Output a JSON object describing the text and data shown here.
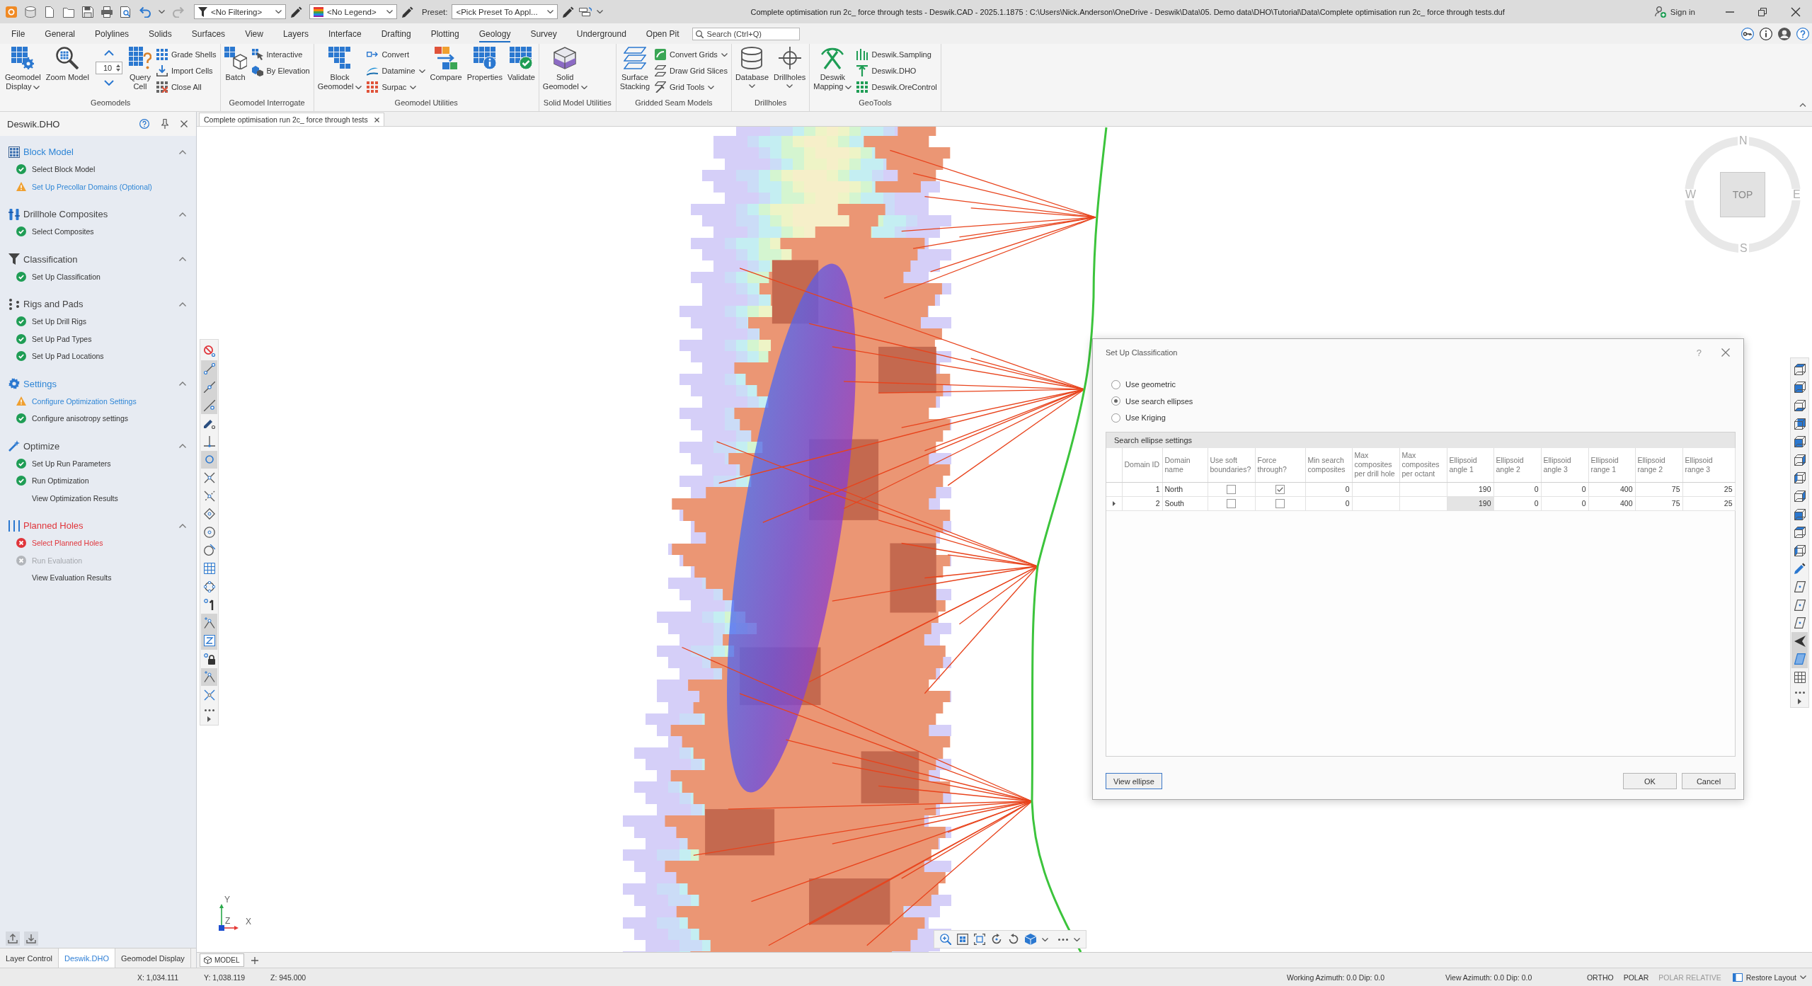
{
  "title_bar": {
    "filters": [
      {
        "kind": "filter",
        "value": "<No Filtering>"
      },
      {
        "kind": "legend",
        "value": "<No Legend>"
      }
    ],
    "preset_label": "Preset:",
    "preset_value": "<Pick Preset To Appl...",
    "title": "Complete optimisation run 2c_ force through tests - Deswik.CAD - 2025.1.1875 : C:\\Users\\Nick.Anderson\\OneDrive - Deswik\\Data\\05. Demo data\\DHO\\Tutorial\\Data\\Complete optimisation run 2c_ force through tests.duf",
    "sign_in": "Sign in"
  },
  "ribbon_tabs": [
    {
      "label": "File",
      "selected": false
    },
    {
      "label": "General",
      "selected": false
    },
    {
      "label": "Polylines",
      "selected": false
    },
    {
      "label": "Solids",
      "selected": false
    },
    {
      "label": "Surfaces",
      "selected": false
    },
    {
      "label": "View",
      "selected": false
    },
    {
      "label": "Layers",
      "selected": false
    },
    {
      "label": "Interface",
      "selected": false
    },
    {
      "label": "Drafting",
      "selected": false
    },
    {
      "label": "Plotting",
      "selected": false
    },
    {
      "label": "Geology",
      "selected": true
    },
    {
      "label": "Survey",
      "selected": false
    },
    {
      "label": "Underground",
      "selected": false
    },
    {
      "label": "Open Pit",
      "selected": false
    }
  ],
  "search": {
    "placeholder": "Search (Ctrl+Q)"
  },
  "ribbon_groups": [
    {
      "label": "Geomodels",
      "items": [
        {
          "kind": "large",
          "label": "Geomodel\nDisplay",
          "dropdown": true
        },
        {
          "kind": "large",
          "label": "Zoom Model",
          "dropdown": false
        },
        {
          "kind": "spinner",
          "value": "10"
        },
        {
          "kind": "large",
          "label": "Query\nCell",
          "dropdown": false
        },
        {
          "kind": "stack",
          "items": [
            {
              "label": "Grade Shells",
              "dropdown": false
            },
            {
              "label": "Import Cells",
              "dropdown": false
            },
            {
              "label": "Close All",
              "dropdown": false
            }
          ]
        }
      ]
    },
    {
      "label": "Geomodel Interrogate",
      "items": [
        {
          "kind": "large",
          "label": "Batch",
          "dropdown": false
        },
        {
          "kind": "stack",
          "items": [
            {
              "label": "Interactive",
              "dropdown": false
            },
            {
              "label": "By Elevation",
              "dropdown": false
            }
          ]
        }
      ]
    },
    {
      "label": "Geomodel Utilities",
      "items": [
        {
          "kind": "large",
          "label": "Block\nGeomodel",
          "dropdown": true
        },
        {
          "kind": "stack",
          "items": [
            {
              "label": "Convert",
              "dropdown": false
            },
            {
              "label": "Datamine",
              "dropdown": true
            },
            {
              "label": "Surpac",
              "dropdown": true
            }
          ]
        },
        {
          "kind": "large",
          "label": "Compare",
          "dropdown": false
        },
        {
          "kind": "large",
          "label": "Properties",
          "dropdown": false
        },
        {
          "kind": "large",
          "label": "Validate",
          "dropdown": false
        }
      ]
    },
    {
      "label": "Solid Model Utilities",
      "items": [
        {
          "kind": "large",
          "label": "Solid\nGeomodel",
          "dropdown": true
        }
      ]
    },
    {
      "label": "Gridded Seam Models",
      "items": [
        {
          "kind": "large",
          "label": "Surface\nStacking",
          "dropdown": false
        },
        {
          "kind": "stack",
          "items": [
            {
              "label": "Convert Grids",
              "dropdown": true
            },
            {
              "label": "Draw Grid Slices",
              "dropdown": false
            },
            {
              "label": "Grid Tools",
              "dropdown": true
            }
          ]
        }
      ]
    },
    {
      "label": "Drillholes",
      "items": [
        {
          "kind": "large",
          "label": "Database",
          "dropdown": true
        },
        {
          "kind": "large",
          "label": "Drillholes",
          "dropdown": true
        }
      ]
    },
    {
      "label": "GeoTools",
      "items": [
        {
          "kind": "large",
          "label": "Deswik\nMapping",
          "dropdown": true
        },
        {
          "kind": "stack",
          "items": [
            {
              "label": "Deswik.Sampling",
              "dropdown": false
            },
            {
              "label": "Deswik.DHO",
              "dropdown": false
            },
            {
              "label": "Deswik.OreControl",
              "dropdown": false
            }
          ]
        }
      ]
    }
  ],
  "panel": {
    "title": "Deswik.DHO",
    "sections": [
      {
        "title": "Block Model",
        "kind": "warning",
        "expanded": true,
        "items": [
          {
            "label": "Select Block Model",
            "kind": "done"
          },
          {
            "label": "Set Up Precollar Domains (Optional)",
            "kind": "warning"
          }
        ]
      },
      {
        "title": "Drillhole Composites",
        "kind": "done",
        "expanded": true,
        "items": [
          {
            "label": "Select Composites",
            "kind": "done"
          }
        ]
      },
      {
        "title": "Classification",
        "kind": "done",
        "expanded": true,
        "items": [
          {
            "label": "Set Up Classification",
            "kind": "done"
          }
        ]
      },
      {
        "title": "Rigs and Pads",
        "kind": "done",
        "expanded": true,
        "items": [
          {
            "label": "Set Up Drill Rigs",
            "kind": "done"
          },
          {
            "label": "Set Up Pad Types",
            "kind": "done"
          },
          {
            "label": "Set Up Pad Locations",
            "kind": "done"
          }
        ]
      },
      {
        "title": "Settings",
        "kind": "warning",
        "expanded": true,
        "items": [
          {
            "label": "Configure Optimization Settings",
            "kind": "warning"
          },
          {
            "label": "Configure anisotropy settings",
            "kind": "done"
          }
        ]
      },
      {
        "title": "Optimize",
        "kind": "done",
        "expanded": true,
        "items": [
          {
            "label": "Set Up Run Parameters",
            "kind": "done"
          },
          {
            "label": "Run Optimization",
            "kind": "done"
          },
          {
            "label": "View Optimization Results",
            "kind": "pending"
          }
        ]
      },
      {
        "title": "Planned Holes",
        "kind": "error",
        "expanded": true,
        "items": [
          {
            "label": "Select Planned Holes",
            "kind": "error"
          },
          {
            "label": "Run Evaluation",
            "kind": "disabled"
          },
          {
            "label": "View Evaluation Results",
            "kind": "pending"
          }
        ]
      }
    ],
    "tabs": [
      {
        "label": "Layer Control",
        "selected": false
      },
      {
        "label": "Deswik.DHO",
        "selected": true
      },
      {
        "label": "Geomodel Display",
        "selected": false
      }
    ]
  },
  "document_tab": {
    "title": "Complete optimisation run 2c_ force through tests"
  },
  "snap_toolbar": [
    {
      "selected": false
    },
    {
      "selected": true
    },
    {
      "selected": true
    },
    {
      "selected": true
    },
    {
      "selected": false
    },
    {
      "selected": false
    },
    {
      "selected": true
    },
    {
      "selected": false
    },
    {
      "selected": false
    },
    {
      "selected": false
    },
    {
      "selected": false
    },
    {
      "selected": false
    },
    {
      "selected": false
    },
    {
      "selected": false
    },
    {
      "selected": false
    },
    {
      "selected": true
    },
    {
      "selected": true
    },
    {
      "selected": false
    },
    {
      "selected": true
    },
    {
      "selected": false
    }
  ],
  "view_toolbar": [
    {
      "selected": false
    },
    {
      "selected": false
    },
    {
      "selected": false
    },
    {
      "selected": false
    },
    {
      "selected": false
    },
    {
      "selected": false
    },
    {
      "selected": false
    },
    {
      "selected": false
    },
    {
      "selected": false
    },
    {
      "selected": false
    },
    {
      "selected": false
    },
    {
      "selected": false
    },
    {
      "selected": false
    },
    {
      "selected": false
    },
    {
      "selected": false
    },
    {
      "selected": true
    },
    {
      "selected": true
    },
    {
      "selected": false
    }
  ],
  "view_cube": {
    "north": "N",
    "east": "E",
    "south": "S",
    "west": "W",
    "face": "TOP"
  },
  "axes": {
    "y": "Y",
    "z": "Z",
    "x": "X"
  },
  "model_tabs": [
    {
      "label": "MODEL",
      "selected": true
    }
  ],
  "dialog": {
    "title": "Set Up Classification",
    "help": "?",
    "options": [
      {
        "label": "Use geometric",
        "selected": false
      },
      {
        "label": "Use search ellipses",
        "selected": true
      },
      {
        "label": "Use Kriging",
        "selected": false
      }
    ],
    "grid_title": "Search ellipse settings",
    "columns": [
      {
        "label": "Domain ID",
        "kind": "number"
      },
      {
        "label": "Domain name",
        "kind": "text"
      },
      {
        "label": "Use soft boundaries?",
        "kind": "check"
      },
      {
        "label": "Force through?",
        "kind": "check"
      },
      {
        "label": "Min search composites",
        "kind": "number"
      },
      {
        "label": "Max composites per drill hole",
        "kind": "number"
      },
      {
        "label": "Max composites per octant",
        "kind": "number"
      },
      {
        "label": "Ellipsoid angle 1",
        "kind": "number"
      },
      {
        "label": "Ellipsoid angle 2",
        "kind": "number"
      },
      {
        "label": "Ellipsoid angle 3",
        "kind": "number"
      },
      {
        "label": "Ellipsoid range 1",
        "kind": "number"
      },
      {
        "label": "Ellipsoid range 2",
        "kind": "number"
      },
      {
        "label": "Ellipsoid range 3",
        "kind": "number"
      }
    ],
    "rows": [
      {
        "current": false,
        "cells": [
          {
            "text": "1",
            "selected": false
          },
          {
            "text": "North",
            "selected": false
          },
          {
            "checked": false,
            "selected": false
          },
          {
            "checked": true,
            "selected": false
          },
          {
            "text": "0",
            "selected": false
          },
          {
            "selected": false
          },
          {
            "selected": false
          },
          {
            "text": "190",
            "selected": false
          },
          {
            "text": "0",
            "selected": false
          },
          {
            "text": "0",
            "selected": false
          },
          {
            "text": "400",
            "selected": false
          },
          {
            "text": "75",
            "selected": false
          },
          {
            "text": "25",
            "selected": false
          }
        ]
      },
      {
        "current": true,
        "cells": [
          {
            "text": "2",
            "selected": false
          },
          {
            "text": "South",
            "selected": false
          },
          {
            "checked": false,
            "selected": false
          },
          {
            "checked": false,
            "selected": false
          },
          {
            "text": "0",
            "selected": false
          },
          {
            "selected": false
          },
          {
            "selected": false
          },
          {
            "text": "190",
            "selected": true
          },
          {
            "text": "0",
            "selected": false
          },
          {
            "text": "0",
            "selected": false
          },
          {
            "text": "400",
            "selected": false
          },
          {
            "text": "75",
            "selected": false
          },
          {
            "text": "25",
            "selected": false
          }
        ]
      }
    ],
    "view_button": {
      "label": "View ellipse",
      "focused": true
    },
    "buttons": [
      {
        "label": "OK",
        "focused": false
      },
      {
        "label": "Cancel",
        "focused": false
      }
    ]
  },
  "status_bar": {
    "coords": [
      "X: 1,034.111",
      "Y: 1,038.119",
      "Z: 945.000"
    ],
    "working_azimuth": "Working Azimuth: 0.0 Dip: 0.0",
    "view_azimuth": "View Azimuth: 0.0 Dip: 0.0",
    "toggles": [
      {
        "label": "ORTHO",
        "on": true
      },
      {
        "label": "POLAR",
        "on": true
      },
      {
        "label": "POLAR RELATIVE",
        "on": false
      }
    ],
    "layout_button": "Restore Layout"
  }
}
